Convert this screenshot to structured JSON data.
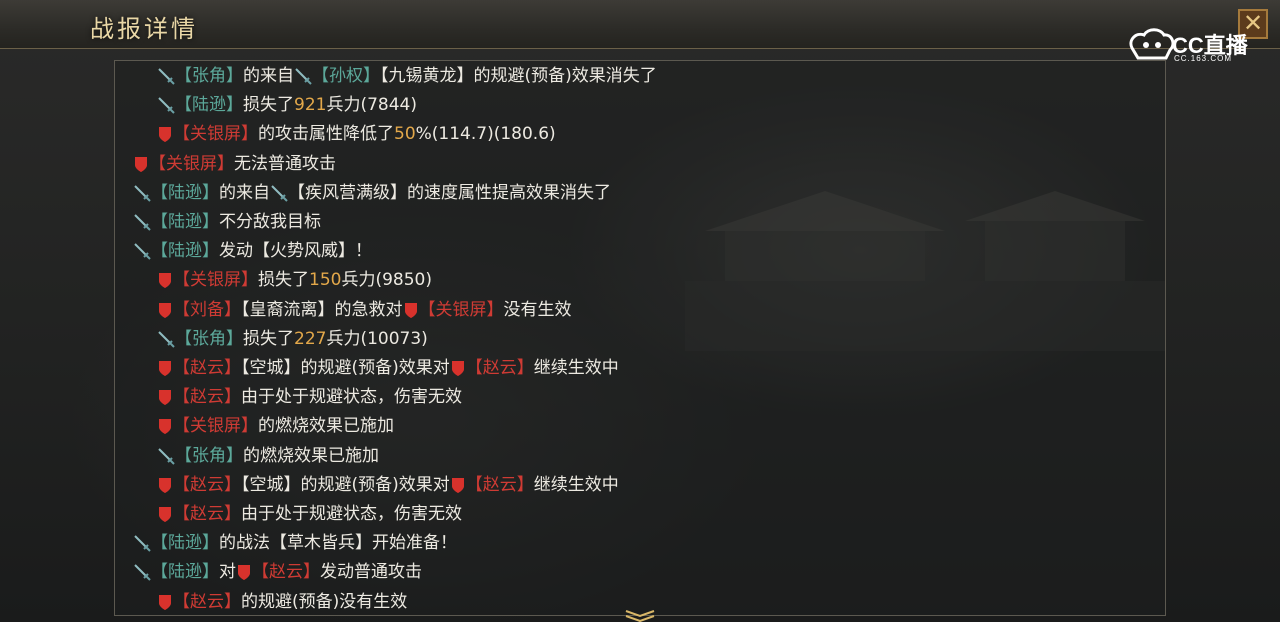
{
  "header": {
    "title": "战报详情"
  },
  "watermark": {
    "brand": "CC直播",
    "url": "CC.163.COM"
  },
  "colors": {
    "red_faction": "#cf3b34",
    "green_faction": "#5ca89a",
    "number": "#e3a84a"
  },
  "log": [
    {
      "indent": 2,
      "segs": [
        {
          "i": "green-sword"
        },
        {
          "t": "【张角】",
          "c": "green"
        },
        {
          "t": "的来自",
          "c": "white"
        },
        {
          "i": "green-sword"
        },
        {
          "t": "【孙权】",
          "c": "green"
        },
        {
          "t": "【九锡黄龙】的规避(预备)效果消失了",
          "c": "white"
        }
      ]
    },
    {
      "indent": 2,
      "segs": [
        {
          "i": "green-sword"
        },
        {
          "t": "【陆逊】",
          "c": "green"
        },
        {
          "t": "损失了",
          "c": "white"
        },
        {
          "t": "921",
          "c": "num"
        },
        {
          "t": "兵力(7844)",
          "c": "white"
        }
      ]
    },
    {
      "indent": 2,
      "segs": [
        {
          "i": "red-shield"
        },
        {
          "t": "【关银屏】",
          "c": "red"
        },
        {
          "t": "的攻击属性降低了",
          "c": "white"
        },
        {
          "t": "50",
          "c": "num"
        },
        {
          "t": "%(114.7)(180.6)",
          "c": "white"
        }
      ]
    },
    {
      "indent": 1,
      "segs": [
        {
          "i": "red-shield"
        },
        {
          "t": "【关银屏】",
          "c": "red"
        },
        {
          "t": "无法普通攻击",
          "c": "white"
        }
      ]
    },
    {
      "indent": 1,
      "segs": [
        {
          "i": "green-sword"
        },
        {
          "t": "【陆逊】",
          "c": "green"
        },
        {
          "t": "的来自",
          "c": "white"
        },
        {
          "i": "green-sword"
        },
        {
          "t": "【疾风营满级】的速度属性提高效果消失了",
          "c": "white"
        }
      ]
    },
    {
      "indent": 1,
      "segs": [
        {
          "i": "green-sword"
        },
        {
          "t": "【陆逊】",
          "c": "green"
        },
        {
          "t": "不分敌我目标",
          "c": "white"
        }
      ]
    },
    {
      "indent": 1,
      "segs": [
        {
          "i": "green-sword"
        },
        {
          "t": "【陆逊】",
          "c": "green"
        },
        {
          "t": "发动【火势风威】！",
          "c": "white"
        }
      ]
    },
    {
      "indent": 2,
      "segs": [
        {
          "i": "red-shield"
        },
        {
          "t": "【关银屏】",
          "c": "red"
        },
        {
          "t": "损失了",
          "c": "white"
        },
        {
          "t": "150",
          "c": "num"
        },
        {
          "t": "兵力(9850)",
          "c": "white"
        }
      ]
    },
    {
      "indent": 2,
      "segs": [
        {
          "i": "red-shield"
        },
        {
          "t": "【刘备】",
          "c": "red"
        },
        {
          "t": "【皇裔流离】的急救对",
          "c": "white"
        },
        {
          "i": "red-shield"
        },
        {
          "t": "【关银屏】",
          "c": "red"
        },
        {
          "t": "没有生效",
          "c": "white"
        }
      ]
    },
    {
      "indent": 2,
      "segs": [
        {
          "i": "green-sword"
        },
        {
          "t": "【张角】",
          "c": "green"
        },
        {
          "t": "损失了",
          "c": "white"
        },
        {
          "t": "227",
          "c": "num"
        },
        {
          "t": "兵力(10073)",
          "c": "white"
        }
      ]
    },
    {
      "indent": 2,
      "segs": [
        {
          "i": "red-shield"
        },
        {
          "t": "【赵云】",
          "c": "red"
        },
        {
          "t": "【空城】的规避(预备)效果对",
          "c": "white"
        },
        {
          "i": "red-shield"
        },
        {
          "t": "【赵云】",
          "c": "red"
        },
        {
          "t": "继续生效中",
          "c": "white"
        }
      ]
    },
    {
      "indent": 2,
      "segs": [
        {
          "i": "red-shield"
        },
        {
          "t": "【赵云】",
          "c": "red"
        },
        {
          "t": "由于处于规避状态，伤害无效",
          "c": "white"
        }
      ]
    },
    {
      "indent": 2,
      "segs": [
        {
          "i": "red-shield"
        },
        {
          "t": "【关银屏】",
          "c": "red"
        },
        {
          "t": "的燃烧效果已施加",
          "c": "white"
        }
      ]
    },
    {
      "indent": 2,
      "segs": [
        {
          "i": "green-sword"
        },
        {
          "t": "【张角】",
          "c": "green"
        },
        {
          "t": "的燃烧效果已施加",
          "c": "white"
        }
      ]
    },
    {
      "indent": 2,
      "segs": [
        {
          "i": "red-shield"
        },
        {
          "t": "【赵云】",
          "c": "red"
        },
        {
          "t": "【空城】的规避(预备)效果对",
          "c": "white"
        },
        {
          "i": "red-shield"
        },
        {
          "t": "【赵云】",
          "c": "red"
        },
        {
          "t": "继续生效中",
          "c": "white"
        }
      ]
    },
    {
      "indent": 2,
      "segs": [
        {
          "i": "red-shield"
        },
        {
          "t": "【赵云】",
          "c": "red"
        },
        {
          "t": "由于处于规避状态，伤害无效",
          "c": "white"
        }
      ]
    },
    {
      "indent": 1,
      "segs": [
        {
          "i": "green-sword"
        },
        {
          "t": "【陆逊】",
          "c": "green"
        },
        {
          "t": "的战法【草木皆兵】开始准备！",
          "c": "white"
        }
      ]
    },
    {
      "indent": 1,
      "segs": [
        {
          "i": "green-sword"
        },
        {
          "t": "【陆逊】",
          "c": "green"
        },
        {
          "t": "对",
          "c": "white"
        },
        {
          "i": "red-shield"
        },
        {
          "t": "【赵云】",
          "c": "red"
        },
        {
          "t": "发动普通攻击",
          "c": "white"
        }
      ]
    },
    {
      "indent": 2,
      "segs": [
        {
          "i": "red-shield"
        },
        {
          "t": "【赵云】",
          "c": "red"
        },
        {
          "t": "的规避(预备)没有生效",
          "c": "white"
        }
      ]
    }
  ]
}
